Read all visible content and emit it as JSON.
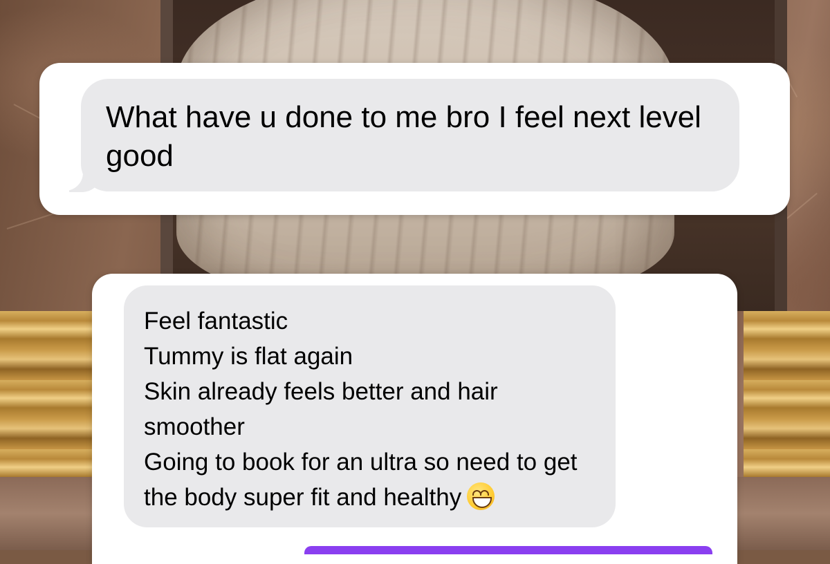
{
  "messages": [
    {
      "text": "What have u done to me bro I feel next level good"
    },
    {
      "lines": [
        "Feel fantastic",
        "Tummy is flat again",
        "Skin already feels better and hair smoother",
        "Going to book for an ultra so need to get the body super fit and healthy"
      ],
      "trailing_emoji": "grinning-face-icon"
    }
  ],
  "colors": {
    "bubble_gray": "#e9e9eb",
    "card_white": "#ffffff",
    "compose_accent": "#8a3ff0"
  }
}
